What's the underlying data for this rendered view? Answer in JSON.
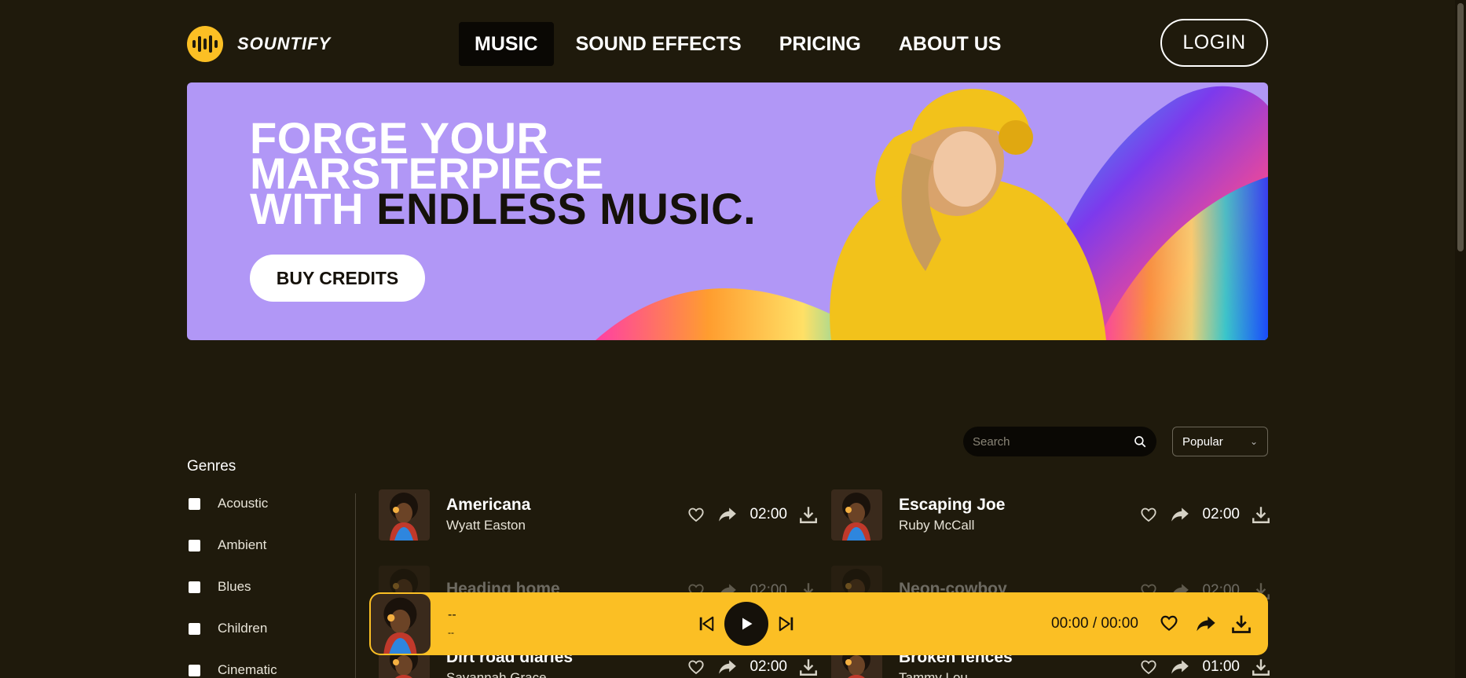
{
  "brand": {
    "name": "SOUNTIFY"
  },
  "nav": {
    "items": [
      "MUSIC",
      "SOUND EFFECTS",
      "PRICING",
      "ABOUT US"
    ],
    "active": "MUSIC",
    "login_label": "LOGIN"
  },
  "hero": {
    "line1": "FORGE YOUR",
    "line2": "MARSTERPIECE",
    "line3_prefix": "WITH ",
    "line3_highlight": "ENDLESS MUSIC.",
    "cta_label": "BUY CREDITS"
  },
  "toolbar": {
    "search_placeholder": "Search",
    "sort_selected": "Popular"
  },
  "sidebar": {
    "title": "Genres",
    "genres": [
      "Acoustic",
      "Ambient",
      "Blues",
      "Children",
      "Cinematic"
    ]
  },
  "tracks": [
    {
      "title": "Americana",
      "artist": "Wyatt Easton",
      "duration": "02:00"
    },
    {
      "title": "Escaping Joe",
      "artist": "Ruby McCall",
      "duration": "02:00"
    },
    {
      "title": "Heading home",
      "artist": "",
      "duration": "02:00"
    },
    {
      "title": "Neon-cowboy",
      "artist": "",
      "duration": "02:00"
    },
    {
      "title": "Dirt road diaries",
      "artist": "Savannah Grace",
      "duration": "02:00"
    },
    {
      "title": "Broken fences",
      "artist": "Tammy Lou",
      "duration": "01:00"
    }
  ],
  "player": {
    "title": "--",
    "artist": "--",
    "time": "00:00 / 00:00"
  },
  "colors": {
    "background": "#1f1a0c",
    "accent": "#fbbf24",
    "hero": "#b197f6"
  }
}
